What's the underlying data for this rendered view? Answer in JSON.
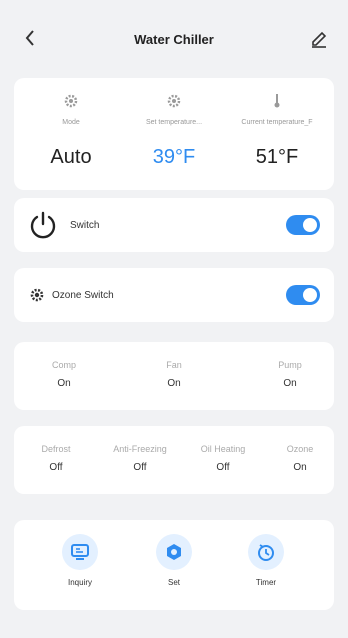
{
  "header": {
    "title": "Water Chiller"
  },
  "stats": [
    {
      "label": "Mode",
      "value": "Auto",
      "icon": "gear-icon"
    },
    {
      "label": "Set temperature...",
      "value": "39°F",
      "icon": "gear-icon"
    },
    {
      "label": "Current temperature_F",
      "value": "51°F",
      "icon": "thermometer-icon"
    }
  ],
  "switch_row": {
    "label": "Switch",
    "on": true
  },
  "ozone_row": {
    "label": "Ozone Switch",
    "on": true
  },
  "status_row1": [
    {
      "label": "Comp",
      "value": "On"
    },
    {
      "label": "Fan",
      "value": "On"
    },
    {
      "label": "Pump",
      "value": "On"
    }
  ],
  "status_row2": [
    {
      "label": "Defrost",
      "value": "Off"
    },
    {
      "label": "Anti-Freezing",
      "value": "Off"
    },
    {
      "label": "Oil Heating",
      "value": "Off"
    },
    {
      "label": "Ozone",
      "value": "On"
    }
  ],
  "tabs": [
    {
      "label": "Inquiry",
      "icon": "inquiry-icon"
    },
    {
      "label": "Set",
      "icon": "settings-hex-icon"
    },
    {
      "label": "Timer",
      "icon": "timer-icon"
    }
  ],
  "colors": {
    "accent": "#2f8cf0",
    "accent_light": "#e3f0ff"
  }
}
